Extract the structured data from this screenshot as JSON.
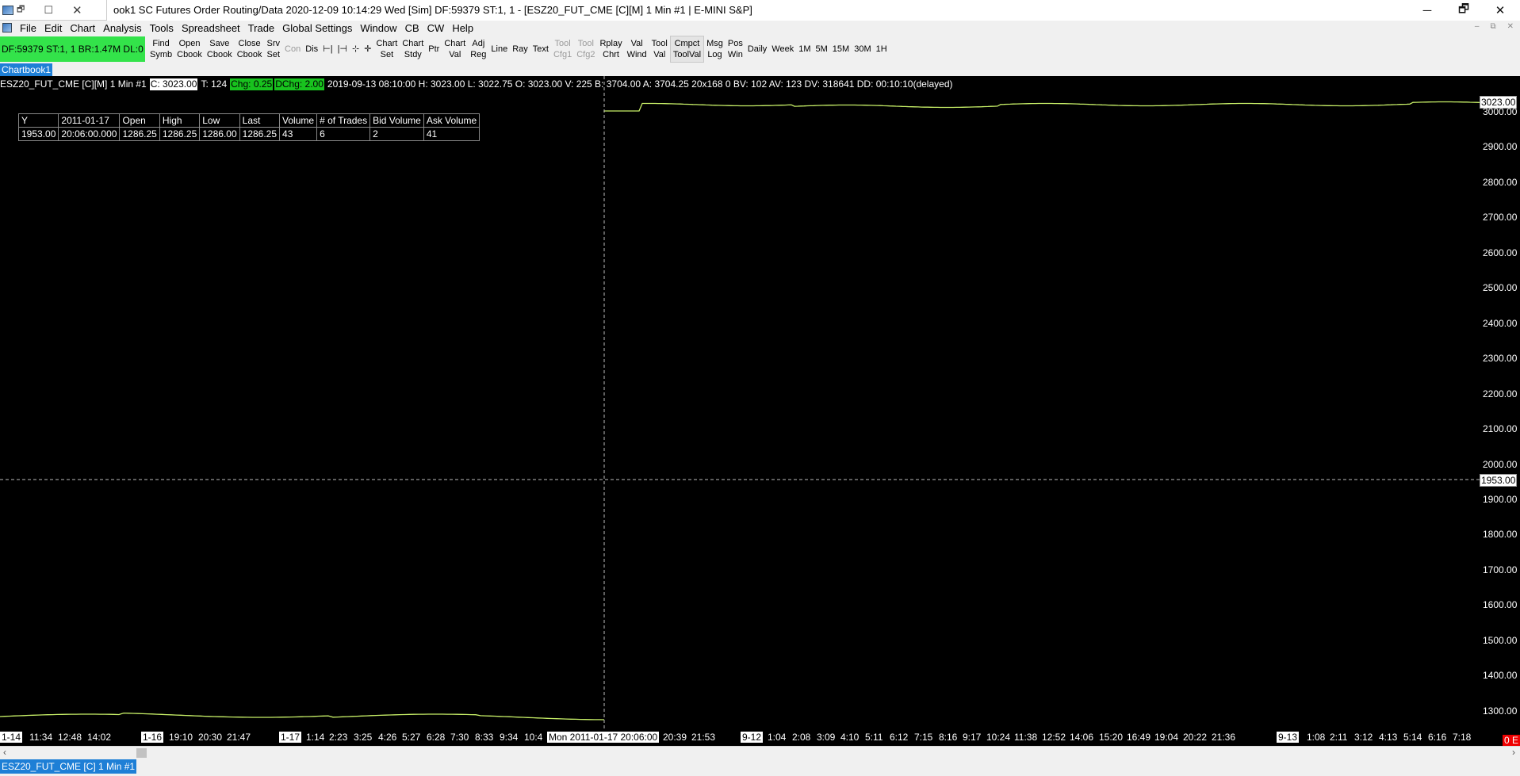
{
  "window": {
    "title": "ook1  SC Futures Order Routing/Data 2020-12-09  10:14:29 Wed [Sim]  DF:59379  ST:1, 1 - [ESZ20_FUT_CME [C][M]  1 Min  #1 | E-MINI S&P]",
    "minimize_icon": "minimize-icon",
    "restore_icon": "restore-icon",
    "close_icon": "close-icon"
  },
  "menu": {
    "items": [
      "File",
      "Edit",
      "Chart",
      "Analysis",
      "Tools",
      "Spreadsheet",
      "Trade",
      "Global Settings",
      "Window",
      "CB",
      "CW",
      "Help"
    ]
  },
  "toolbar": {
    "status": "DF:59379  ST:1, 1  BR:1.47M  DL:0",
    "status_color": "#33e34a",
    "buttons": [
      {
        "l1": "Find",
        "l2": "Symb",
        "enabled": true
      },
      {
        "l1": "Open",
        "l2": "Cbook",
        "enabled": true
      },
      {
        "l1": "Save",
        "l2": "Cbook",
        "enabled": true
      },
      {
        "l1": "Close",
        "l2": "Cbook",
        "enabled": true
      },
      {
        "l1": "Srv",
        "l2": "Set",
        "enabled": true
      },
      {
        "l1": "Con",
        "l2": "",
        "enabled": false
      },
      {
        "l1": "Dis",
        "l2": "",
        "enabled": true
      },
      {
        "l1": "⊢|",
        "l2": "",
        "enabled": true
      },
      {
        "l1": "|⊣",
        "l2": "",
        "enabled": true
      },
      {
        "l1": "⊹",
        "l2": "",
        "enabled": true
      },
      {
        "l1": "✛",
        "l2": "",
        "enabled": true
      },
      {
        "l1": "Chart",
        "l2": "Set",
        "enabled": true
      },
      {
        "l1": "Chart",
        "l2": "Stdy",
        "enabled": true
      },
      {
        "l1": "Ptr",
        "l2": "",
        "enabled": true
      },
      {
        "l1": "Chart",
        "l2": "Val",
        "enabled": true
      },
      {
        "l1": "Adj",
        "l2": "Reg",
        "enabled": true
      },
      {
        "l1": "Line",
        "l2": "",
        "enabled": true
      },
      {
        "l1": "Ray",
        "l2": "",
        "enabled": true
      },
      {
        "l1": "Text",
        "l2": "",
        "enabled": true
      },
      {
        "l1": "Tool",
        "l2": "Cfg1",
        "enabled": false
      },
      {
        "l1": "Tool",
        "l2": "Cfg2",
        "enabled": false
      },
      {
        "l1": "Rplay",
        "l2": "Chrt",
        "enabled": true
      },
      {
        "l1": "Val",
        "l2": "Wind",
        "enabled": true
      },
      {
        "l1": "Tool",
        "l2": "Val",
        "enabled": true
      },
      {
        "l1": "Cmpct",
        "l2": "ToolVal",
        "enabled": true,
        "pressed": true
      },
      {
        "l1": "Msg",
        "l2": "Log",
        "enabled": true
      },
      {
        "l1": "Pos",
        "l2": "Win",
        "enabled": true
      },
      {
        "l1": "Daily",
        "l2": "",
        "enabled": true
      },
      {
        "l1": "Week",
        "l2": "",
        "enabled": true
      },
      {
        "l1": "1M",
        "l2": "",
        "enabled": true
      },
      {
        "l1": "5M",
        "l2": "",
        "enabled": true
      },
      {
        "l1": "15M",
        "l2": "",
        "enabled": true
      },
      {
        "l1": "30M",
        "l2": "",
        "enabled": true
      },
      {
        "l1": "1H",
        "l2": "",
        "enabled": true
      }
    ]
  },
  "chartbook_tab": "Chartbook1",
  "chart": {
    "header": {
      "prefix": "ESZ20_FUT_CME [C][M]  1 Min   #1",
      "close": "C: 3023.00",
      "trades": "T: 124",
      "chg": "Chg: 0.25",
      "dchg": "DChg: 2.00",
      "rest": "2019-09-13 08:10:00 H: 3023.00 L: 3022.75 O: 3023.00 V: 225 B: 3704.00 A: 3704.25 20x168 0 BV: 102 AV: 123 DV: 318641 DD: 00:10:10(delayed)"
    },
    "table": {
      "headers": [
        "Y",
        "2011-01-17",
        "Open",
        "High",
        "Low",
        "Last",
        "Volume",
        "# of Trades",
        "Bid Volume",
        "Ask Volume"
      ],
      "row": [
        "1953.00",
        "20:06:00.000",
        "1286.25",
        "1286.25",
        "1286.00",
        "1286.25",
        "43",
        "6",
        "2",
        "41"
      ]
    },
    "price_labels": [
      "3000.00",
      "2900.00",
      "2800.00",
      "2700.00",
      "2600.00",
      "2500.00",
      "2400.00",
      "2300.00",
      "2200.00",
      "2100.00",
      "2000.00",
      "1900.00",
      "1800.00",
      "1700.00",
      "1600.00",
      "1500.00",
      "1400.00",
      "1300.00"
    ],
    "last_price_box": "3023.00",
    "cursor_price_box": "1953.00",
    "end_marker": "0 E",
    "time_labels": [
      {
        "t": "1-14",
        "boxed": true
      },
      {
        "t": "11:34"
      },
      {
        "t": "12:48"
      },
      {
        "t": "14:02"
      },
      {
        "t": "1-16",
        "boxed": true
      },
      {
        "t": "19:10"
      },
      {
        "t": "20:30"
      },
      {
        "t": "21:47"
      },
      {
        "t": "1-17",
        "boxed": true
      },
      {
        "t": "1:14"
      },
      {
        "t": "2:23"
      },
      {
        "t": "3:25"
      },
      {
        "t": "4:26"
      },
      {
        "t": "5:27"
      },
      {
        "t": "6:28"
      },
      {
        "t": "7:30"
      },
      {
        "t": "8:33"
      },
      {
        "t": "9:34"
      },
      {
        "t": "10:4"
      },
      {
        "t": "Mon 2011-01-17  20:06:00",
        "boxed": true
      },
      {
        "t": "20:39"
      },
      {
        "t": "21:53"
      },
      {
        "t": "9-12",
        "boxed": true
      },
      {
        "t": "1:04"
      },
      {
        "t": "2:08"
      },
      {
        "t": "3:09"
      },
      {
        "t": "4:10"
      },
      {
        "t": "5:11"
      },
      {
        "t": "6:12"
      },
      {
        "t": "7:15"
      },
      {
        "t": "8:16"
      },
      {
        "t": "9:17"
      },
      {
        "t": "10:24"
      },
      {
        "t": "11:38"
      },
      {
        "t": "12:52"
      },
      {
        "t": "14:06"
      },
      {
        "t": "15:20"
      },
      {
        "t": "16:49"
      },
      {
        "t": "19:04"
      },
      {
        "t": "20:22"
      },
      {
        "t": "21:36"
      },
      {
        "t": "9-13",
        "boxed": true
      },
      {
        "t": "1:08"
      },
      {
        "t": "2:11"
      },
      {
        "t": "3:12"
      },
      {
        "t": "4:13"
      },
      {
        "t": "5:14"
      },
      {
        "t": "6:16"
      },
      {
        "t": "7:18"
      }
    ],
    "line_color": "#c8f068",
    "grid": false
  },
  "bottom_tab": "ESZ20_FUT_CME [C]  1 Min   #1"
}
